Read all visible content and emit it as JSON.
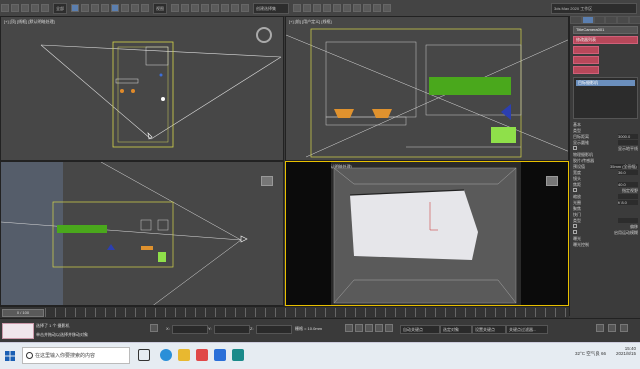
{
  "toolbar": {
    "selection_filter": "全部",
    "view_mode": "视图",
    "named_selection": "创建选择集",
    "workspace": "3ds Max 2020 工作区"
  },
  "viewports": [
    {
      "label": "[+] [顶] [线框] [默认明暗处理]"
    },
    {
      "label": "[+] [前] [用户定义] [线框]"
    },
    {
      "label": "[+] [左] [用户定义] [线框]"
    },
    {
      "label": "[+] [透视] [用户定义] [默认明暗处理]"
    }
  ],
  "command_panel": {
    "object_name": "TitleCamera001",
    "modifier_list": "修改器列表",
    "stack_item": "目标摄影机",
    "section_basic": "基本",
    "param_type": "类型",
    "param_target_distance": "目标距离",
    "target_distance_value": "3000.0",
    "param_display_cone": "显示圆锥",
    "param_show_horizon": "显示地平线",
    "section_physical": "物理摄影机",
    "param_film": "胶片/传感器",
    "param_preset": "预设值",
    "preset_value": "35mm (全画幅)",
    "param_width": "宽度",
    "width_value": "36.0",
    "param_lens": "镜头",
    "param_focal": "焦距",
    "focal_value": "40.0",
    "param_fov": "指定视野",
    "param_zoom": "缩放",
    "param_aperture": "光圈",
    "aperture_value": "f/ 8.0",
    "param_focus": "聚焦",
    "param_shutter": "快门",
    "param_type2": "类型",
    "param_offset": "偏移",
    "param_motion_blur": "启用运动模糊",
    "param_exposure": "曝光",
    "param_exposure_control": "曝光控制"
  },
  "timeline": {
    "frame": "0 / 100"
  },
  "status": {
    "selection_info": "选择了 1 个 摄影机",
    "prompt": "单击并拖动以选择并移动对象",
    "x_label": "X:",
    "y_label": "Y:",
    "z_label": "Z:",
    "grid": "栅格 = 10.0mm",
    "autokey": "自动关键点",
    "selected": "选定对象",
    "set_key": "设置关键点",
    "key_filters": "关键点过滤器..."
  },
  "taskbar": {
    "search_placeholder": "在这里输入你要搜索的内容",
    "weather": "32°C 空气良 66",
    "time": "15:40",
    "date": "2021/8/15"
  }
}
